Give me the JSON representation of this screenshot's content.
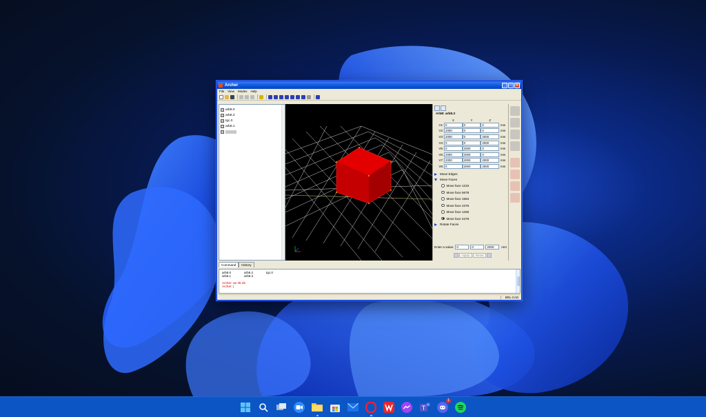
{
  "window": {
    "title": "Archer",
    "menu": [
      "File",
      "View",
      "Modes",
      "Help"
    ],
    "buttons": {
      "minimize": "_",
      "maximize": "□",
      "close": "×"
    }
  },
  "tree": {
    "items": [
      {
        "label": "arb8.0",
        "selected": false
      },
      {
        "label": "arb8.2",
        "selected": false
      },
      {
        "label": "tgc.0",
        "selected": false
      },
      {
        "label": "arb8.1",
        "selected": false
      },
      {
        "label": "arb8.3",
        "selected": true
      }
    ]
  },
  "panel": {
    "object_title": "Arb8: arb8.3",
    "columns": [
      "X",
      "Y",
      "Z"
    ],
    "vertices": [
      {
        "label": "V1:",
        "x": "0",
        "y": "0",
        "z": "0",
        "unit": "mm"
      },
      {
        "label": "V2:",
        "x": "2000",
        "y": "0",
        "z": "0",
        "unit": "mm"
      },
      {
        "label": "V3:",
        "x": "2000",
        "y": "0",
        "z": "2000",
        "unit": "mm"
      },
      {
        "label": "V4:",
        "x": "0",
        "y": "0",
        "z": "2000",
        "unit": "mm"
      },
      {
        "label": "V5:",
        "x": "0",
        "y": "2000",
        "z": "0",
        "unit": "mm"
      },
      {
        "label": "V6:",
        "x": "2000",
        "y": "2000",
        "z": "0",
        "unit": "mm"
      },
      {
        "label": "V7:",
        "x": "2000",
        "y": "2000",
        "z": "2000",
        "unit": "mm"
      },
      {
        "label": "V8:",
        "x": "0",
        "y": "2000",
        "z": "2000",
        "unit": "mm"
      }
    ],
    "move_edges": "Move Edges",
    "move_faces": "Move Faces",
    "faces": [
      {
        "label": "Move face 1234",
        "checked": false
      },
      {
        "label": "Move face 5678",
        "checked": false
      },
      {
        "label": "Move face 1584",
        "checked": false
      },
      {
        "label": "Move face 2376",
        "checked": false
      },
      {
        "label": "Move face 1265",
        "checked": false
      },
      {
        "label": "Move face 4378",
        "checked": true
      }
    ],
    "rotate_faces": "Rotate Faces",
    "enter_label": "Enter a value:",
    "enter_values": [
      "0",
      "0",
      "2000"
    ],
    "enter_unit": "mm",
    "apply": "Apply",
    "reset": "Reset"
  },
  "console": {
    "tabs": [
      "Command",
      "History"
    ],
    "listing": [
      [
        "arb8.0",
        "arb8.2",
        "tgc.0"
      ],
      [
        "arb8.1",
        "arb8.3",
        ""
      ]
    ],
    "lines": [
      "Archer: ae 35 25",
      "Archer: |"
    ]
  },
  "status": {
    "right": "BRL-CAD"
  },
  "colors": {
    "accent": "#0b55d8",
    "object": "#cc0000",
    "grid": "#d8d8d8",
    "taskbar": "#0b56c4"
  },
  "taskbar": {
    "icons": [
      "windows-start-icon",
      "search-icon",
      "task-view-icon",
      "zoom-icon",
      "file-explorer-icon",
      "store-icon",
      "mail-icon",
      "opera-icon",
      "wps-office-icon",
      "messenger-icon",
      "teams-icon",
      "discord-icon",
      "spotify-icon"
    ],
    "discord_badge": "1"
  }
}
